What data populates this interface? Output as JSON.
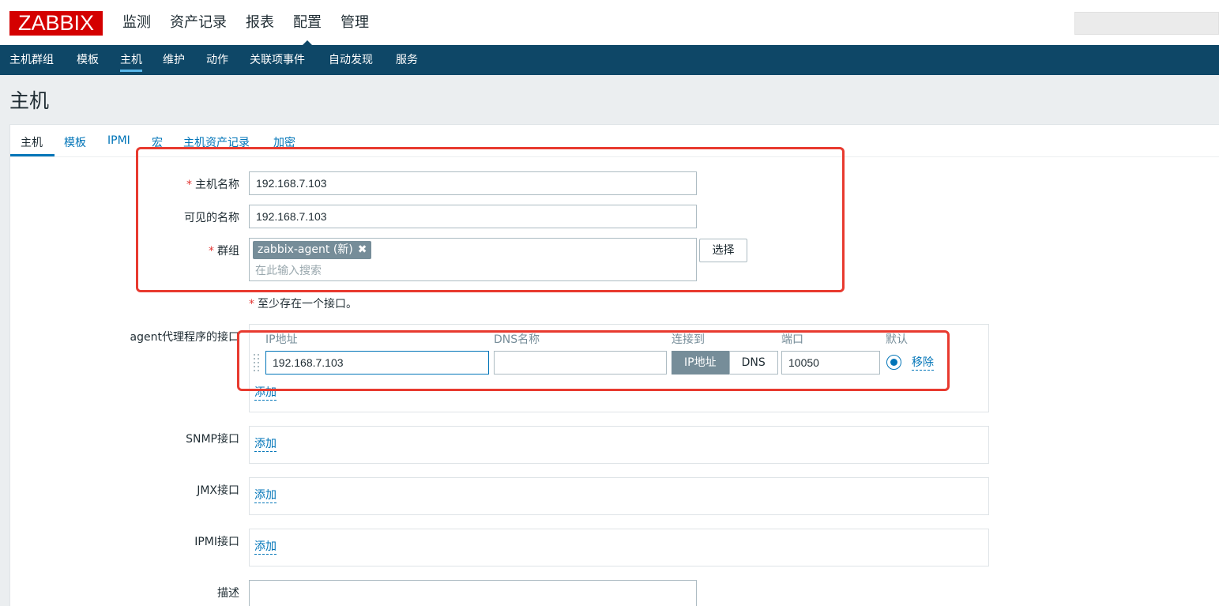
{
  "header": {
    "logo": "ZABBIX",
    "menu": [
      "监测",
      "资产记录",
      "报表",
      "配置",
      "管理"
    ],
    "active_menu": "配置"
  },
  "submenu": [
    "主机群组",
    "模板",
    "主机",
    "维护",
    "动作",
    "关联项事件",
    "自动发现",
    "服务"
  ],
  "page_title": "主机",
  "tabs": [
    "主机",
    "模板",
    "IPMI",
    "宏",
    "主机资产记录",
    "加密"
  ],
  "form": {
    "host_name_label": "主机名称",
    "host_name_value": "192.168.7.103",
    "visible_name_label": "可见的名称",
    "visible_name_value": "192.168.7.103",
    "groups_label": "群组",
    "group_tag": "zabbix-agent (新)",
    "group_remove": "✖",
    "groups_placeholder": "在此输入搜索",
    "select_button": "选择",
    "required_mark": "*",
    "interface_note": "至少存在一个接口。"
  },
  "agent_interfaces": {
    "label": "agent代理程序的接口",
    "headers": [
      "IP地址",
      "DNS名称",
      "连接到",
      "端口",
      "默认"
    ],
    "ip": "192.168.7.103",
    "dns": "",
    "connect_options": [
      "IP地址",
      "DNS"
    ],
    "connect_selected": "IP地址",
    "port": "10050",
    "remove_link": "移除",
    "add_link": "添加"
  },
  "snmp": {
    "label": "SNMP接口",
    "add_link": "添加"
  },
  "jmx": {
    "label": "JMX接口",
    "add_link": "添加"
  },
  "ipmi": {
    "label": "IPMI接口",
    "add_link": "添加"
  },
  "description": {
    "label": "描述"
  },
  "colors": {
    "brand": "#d40000",
    "nav": "#0e4767",
    "link": "#0275b8",
    "annotation": "#e83a2f"
  }
}
